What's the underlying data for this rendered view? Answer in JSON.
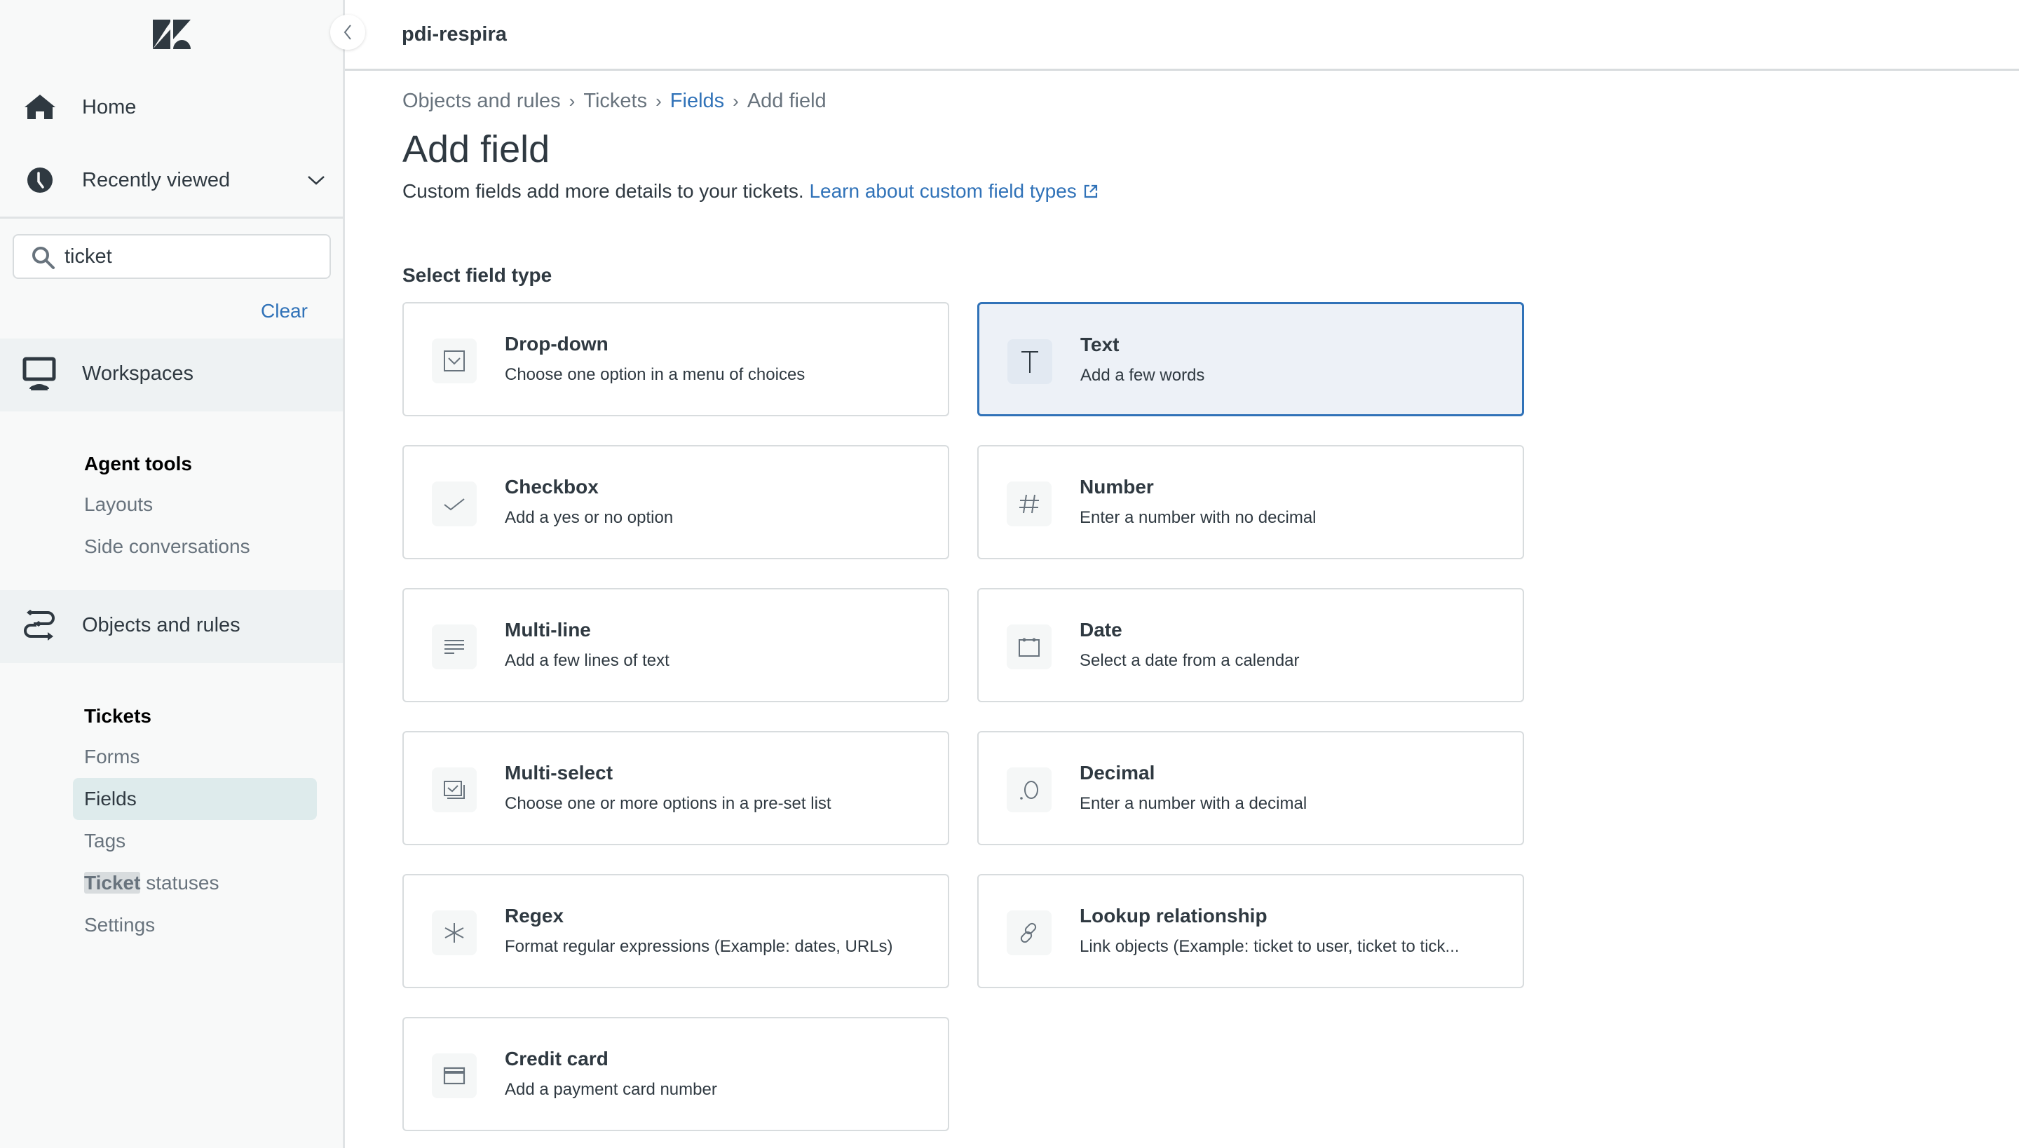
{
  "header": {
    "instance_name": "pdi-respira"
  },
  "sidebar": {
    "logo": "zendesk-logo",
    "nav": [
      {
        "label": "Home",
        "icon": "home-icon"
      },
      {
        "label": "Recently viewed",
        "icon": "clock-icon",
        "expandable": true
      }
    ],
    "search": {
      "value": "ticket",
      "placeholder": ""
    },
    "clear_label": "Clear",
    "workspaces": {
      "label": "Workspaces",
      "group": {
        "heading": "Agent tools",
        "items": [
          "Layouts",
          "Side conversations"
        ]
      }
    },
    "objects_and_rules": {
      "label": "Objects and rules",
      "group": {
        "heading": "Tickets",
        "items": [
          "Forms",
          "Fields",
          "Tags",
          "Ticket statuses",
          "Settings"
        ],
        "active": "Fields",
        "highlight_match": "Ticket",
        "highlight_rest": " statuses"
      }
    }
  },
  "breadcrumb": [
    {
      "label": "Objects and rules",
      "link": false
    },
    {
      "label": "Tickets",
      "link": false
    },
    {
      "label": "Fields",
      "link": true
    },
    {
      "label": "Add field",
      "link": false
    }
  ],
  "page": {
    "title": "Add field",
    "description": "Custom fields add more details to your tickets.",
    "learn_link": "Learn about custom field types",
    "section_label": "Select field type"
  },
  "field_types": [
    {
      "title": "Drop-down",
      "description": "Choose one option in a menu of choices",
      "icon": "dropdown-icon",
      "selected": false
    },
    {
      "title": "Text",
      "description": "Add a few words",
      "icon": "text-icon",
      "selected": true
    },
    {
      "title": "Checkbox",
      "description": "Add a yes or no option",
      "icon": "checkmark-icon",
      "selected": false
    },
    {
      "title": "Number",
      "description": "Enter a number with no decimal",
      "icon": "hash-icon",
      "selected": false
    },
    {
      "title": "Multi-line",
      "description": "Add a few lines of text",
      "icon": "multiline-icon",
      "selected": false
    },
    {
      "title": "Date",
      "description": "Select a date from a calendar",
      "icon": "calendar-icon",
      "selected": false
    },
    {
      "title": "Multi-select",
      "description": "Choose one or more options in a pre-set list",
      "icon": "multiselect-icon",
      "selected": false
    },
    {
      "title": "Decimal",
      "description": "Enter a number with a decimal",
      "icon": "decimal-icon",
      "selected": false
    },
    {
      "title": "Regex",
      "description": "Format regular expressions (Example: dates, URLs)",
      "icon": "asterisk-icon",
      "selected": false
    },
    {
      "title": "Lookup relationship",
      "description": "Link objects (Example: ticket to user, ticket to tick...",
      "icon": "link-icon",
      "selected": false
    },
    {
      "title": "Credit card",
      "description": "Add a payment card number",
      "icon": "credit-card-icon",
      "selected": false
    }
  ],
  "colors": {
    "accent": "#3072b8",
    "text": "#2f3941",
    "muted": "#68737d",
    "sidebar_bg": "#f8f9f9",
    "active_item": "#deebec"
  }
}
